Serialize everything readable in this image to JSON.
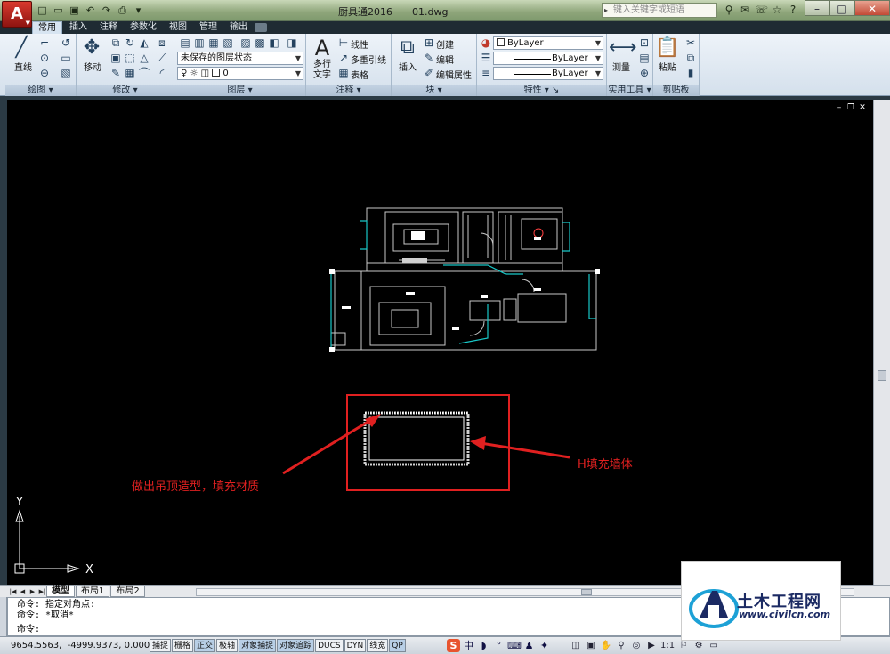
{
  "window": {
    "title": "厨具通2016",
    "file": "01.dwg",
    "search_placeholder": "键入关键字或短语"
  },
  "ribbon_tabs": [
    "常用",
    "插入",
    "注释",
    "参数化",
    "视图",
    "管理",
    "输出"
  ],
  "panels": {
    "draw": {
      "title": "绘图",
      "line_label": "直线"
    },
    "modify": {
      "title": "修改",
      "move_label": "移动"
    },
    "layers": {
      "title": "图层",
      "layer_state": "未保存的图层状态",
      "current_layer": "0"
    },
    "annotation": {
      "title": "注释",
      "mtext_label": "多行文字",
      "linear_label": "线性",
      "mleader_label": "多重引线",
      "table_label": "表格"
    },
    "block": {
      "title": "块",
      "insert_label": "插入",
      "create_label": "创建",
      "edit_label": "编辑",
      "edit_attr_label": "编辑属性"
    },
    "properties": {
      "title": "特性",
      "color": "ByLayer",
      "linetype": "ByLayer",
      "lineweight": "ByLayer"
    },
    "utilities": {
      "title": "实用工具",
      "measure_label": "测量"
    },
    "clipboard": {
      "title": "剪贴板",
      "paste_label": "粘贴"
    }
  },
  "drawing": {
    "annotation_left": "做出吊顶造型，填充材质",
    "annotation_right": "H填充墙体",
    "ucs_y": "Y",
    "ucs_x": "X",
    "colors": {
      "highlight": "#e02020",
      "plan_lines": "#c9c9c9",
      "window_lines": "#18c8c8"
    }
  },
  "layout_tabs": [
    "模型",
    "布局1",
    "布局2"
  ],
  "command": {
    "line1": "命令: 指定对角点:",
    "line2": "命令: *取消*",
    "prompt": "命令:"
  },
  "status": {
    "coords": "9654.5563,  -4999.9373, 0.0000",
    "toggles": [
      {
        "label": "捕捉",
        "on": false
      },
      {
        "label": "栅格",
        "on": false
      },
      {
        "label": "正交",
        "on": true
      },
      {
        "label": "极轴",
        "on": false
      },
      {
        "label": "对象捕捉",
        "on": true
      },
      {
        "label": "对象追踪",
        "on": true
      },
      {
        "label": "DUCS",
        "on": false
      },
      {
        "label": "DYN",
        "on": false
      },
      {
        "label": "线宽",
        "on": false
      },
      {
        "label": "QP",
        "on": true
      }
    ],
    "ime_label": "中",
    "scale": "1:1"
  },
  "watermark": {
    "title": "土木工程网",
    "url": "www.civilcn.com"
  }
}
